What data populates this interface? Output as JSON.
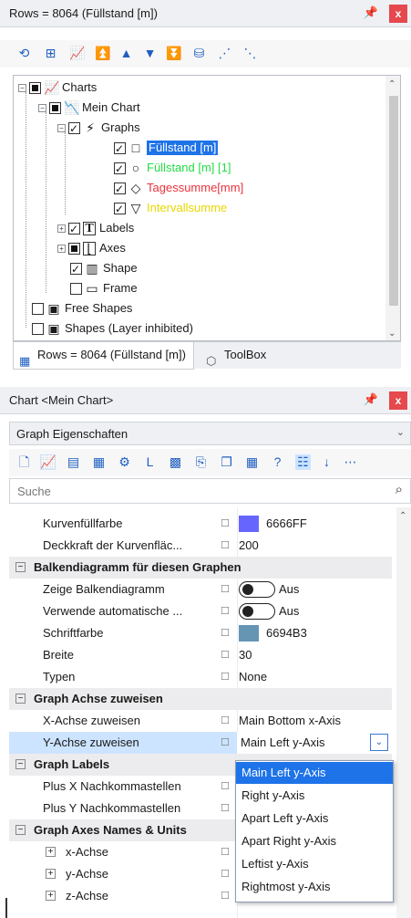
{
  "top_panel": {
    "title": "Rows = 8064 (Füllstand [m])",
    "pin": "ᵖ",
    "close": "x"
  },
  "toolbar_icons": [
    "zoom-reset-icon",
    "fit-icon",
    "chart-edit-icon",
    "first-icon",
    "prev-icon",
    "next-icon",
    "last-icon",
    "filter-icon",
    "group-icon",
    "ungroup-icon"
  ],
  "tree": {
    "nodes": [
      {
        "label": "Charts",
        "level": 0,
        "expander": "−",
        "check": "filled",
        "glyph": "📈"
      },
      {
        "label": "Mein Chart",
        "level": 1,
        "expander": "−",
        "check": "filled",
        "glyph": "📉"
      },
      {
        "label": "Graphs",
        "level": 2,
        "expander": "−",
        "check": "checked",
        "glyph": "⚡"
      },
      {
        "label": "Füllstand [m]",
        "level": 3,
        "check": "checked",
        "glyph": "□",
        "selected": true
      },
      {
        "label": "Füllstand [m] [1]",
        "level": 3,
        "check": "checked",
        "glyph": "○",
        "color": "#22dd44"
      },
      {
        "label": "Tagessumme[mm]",
        "level": 3,
        "check": "checked",
        "glyph": "◇",
        "color": "#e8333c"
      },
      {
        "label": "Intervallsumme",
        "level": 3,
        "check": "checked",
        "glyph": "▽",
        "color": "#f0e000"
      },
      {
        "label": "Labels",
        "level": 2,
        "expander": "+",
        "check": "checked",
        "glyph": "T"
      },
      {
        "label": "Axes",
        "level": 2,
        "expander": "+",
        "check": "filled",
        "glyph": "⌊"
      },
      {
        "label": "Shape",
        "level": 2,
        "check": "checked",
        "glyph": "▥"
      },
      {
        "label": "Frame",
        "level": 2,
        "check": "empty",
        "glyph": "▭"
      },
      {
        "label": "Free Shapes",
        "level": 0,
        "check": "empty",
        "glyph": "▣"
      },
      {
        "label": "Shapes (Layer inhibited)",
        "level": 0,
        "check": "empty",
        "glyph": "▣"
      }
    ]
  },
  "tabs": [
    {
      "label": "Rows = 8064 (Füllstand [m])",
      "active": true
    },
    {
      "label": "ToolBox",
      "active": false
    }
  ],
  "bottom_panel": {
    "title": "Chart <Mein Chart>",
    "pin": "ᵖ",
    "close": "x",
    "combo": "Graph Eigenschaften",
    "search_placeholder": "Suche"
  },
  "property_toolbar_icons": [
    "new-icon",
    "chart-props-icon",
    "data-icon",
    "table-icon",
    "settings-icon",
    "label-icon",
    "color-icon",
    "export-icon",
    "copy-icon",
    "grid-icon",
    "help-icon",
    "categorized-icon",
    "alphabetical-icon",
    "more-icon"
  ],
  "properties": [
    {
      "kind": "prop",
      "name": "Kurvenfüllfarbe",
      "value": "6666FF",
      "swatch": "#6666FF"
    },
    {
      "kind": "prop",
      "name": "Deckkraft der Kurvenfläc...",
      "value": "200"
    },
    {
      "kind": "cat",
      "name": "Balkendiagramm für diesen Graphen"
    },
    {
      "kind": "prop",
      "name": "Zeige Balkendiagramm",
      "value": "Aus",
      "toggle": true
    },
    {
      "kind": "prop",
      "name": "Verwende automatische ...",
      "value": "Aus",
      "toggle": true
    },
    {
      "kind": "prop",
      "name": "Schriftfarbe",
      "value": "6694B3",
      "swatch": "#6694B3"
    },
    {
      "kind": "prop",
      "name": "Breite",
      "value": "30"
    },
    {
      "kind": "prop",
      "name": "Typen",
      "value": "None"
    },
    {
      "kind": "cat",
      "name": "Graph Achse zuweisen"
    },
    {
      "kind": "prop",
      "name": "X-Achse zuweisen",
      "value": "Main Bottom x-Axis"
    },
    {
      "kind": "prop",
      "name": "Y-Achse zuweisen",
      "value": "Main Left y-Axis",
      "highlight": true,
      "dropdown": true
    },
    {
      "kind": "cat",
      "name": "Graph Labels"
    },
    {
      "kind": "prop",
      "name": "Plus X Nachkommastellen",
      "value": ""
    },
    {
      "kind": "prop",
      "name": "Plus Y Nachkommastellen",
      "value": ""
    },
    {
      "kind": "cat",
      "name": "Graph Axes Names & Units"
    },
    {
      "kind": "sub",
      "name": "x-Achse",
      "value": ""
    },
    {
      "kind": "sub",
      "name": "y-Achse",
      "value": ""
    },
    {
      "kind": "sub",
      "name": "z-Achse",
      "value": "-,-"
    }
  ],
  "dropdown": {
    "options": [
      "Main Left y-Axis",
      "Right y-Axis",
      "Apart Left y-Axis",
      "Apart Right y-Axis",
      "Leftist y-Axis",
      "Rightmost y-Axis"
    ],
    "selected": 0
  },
  "colors": {
    "selection": "#1e73e8",
    "highlight_row": "#cce4ff",
    "category_bg": "#ececee",
    "close_button": "#e5484d"
  }
}
